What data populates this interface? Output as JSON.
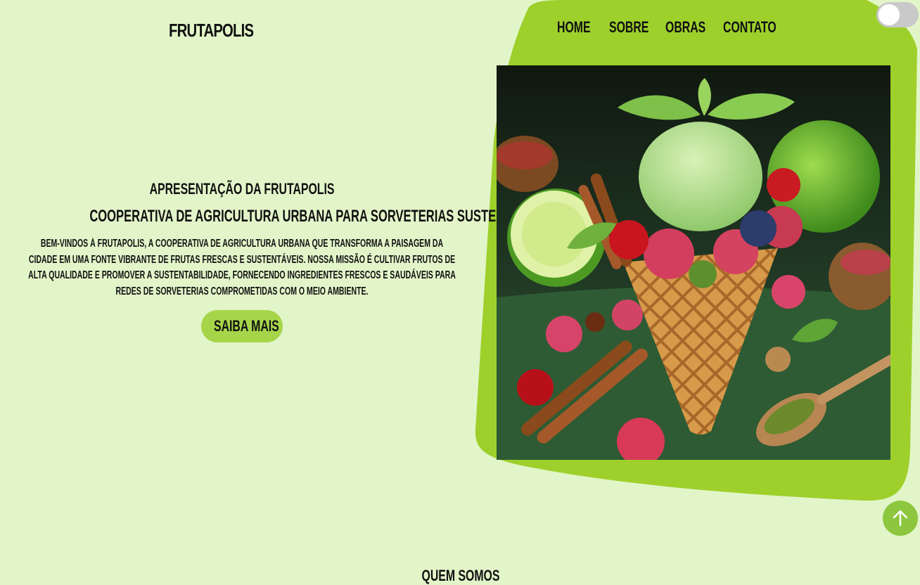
{
  "brand": {
    "part1": "FRUTA",
    "part2": "POLIS"
  },
  "nav": {
    "home": "HOME",
    "sobre": "SOBRE",
    "obras": "OBRAS",
    "contato": "CONTATO"
  },
  "hero": {
    "title_prefix": "APRESENTAÇÃO DA ",
    "title_brand": "FRUTAPOLIS",
    "subtitle": "COOPERATIVA DE AGRICULTURA URBANA PARA SORVETERIAS SUSTENTÁVEIS",
    "body": "BEM-VINDOS À FRUTAPOLIS, A COOPERATIVA DE AGRICULTURA URBANA QUE TRANSFORMA A PAISAGEM DA CIDADE EM UMA FONTE VIBRANTE DE FRUTAS FRESCAS E SUSTENTÁVEIS. NOSSA MISSÃO É CULTIVAR FRUTOS DE ALTA QUALIDADE E PROMOVER A SUSTENTABILIDADE, FORNECENDO INGREDIENTES FRESCOS E SAUDÁVEIS PARA REDES DE SORVETERIAS COMPROMETIDAS COM O MEIO AMBIENTE.",
    "cta_label": "SAIBA MAIS"
  },
  "next_section": {
    "heading": "QUEM SOMOS"
  },
  "icons": {
    "scroll_top": "arrow-up-icon",
    "theme_toggle": "toggle-switch"
  },
  "colors": {
    "background": "#e2f5c9",
    "accent": "#a6d54a",
    "blob": "#9ed02c",
    "scroll_button": "#8dc63f"
  }
}
